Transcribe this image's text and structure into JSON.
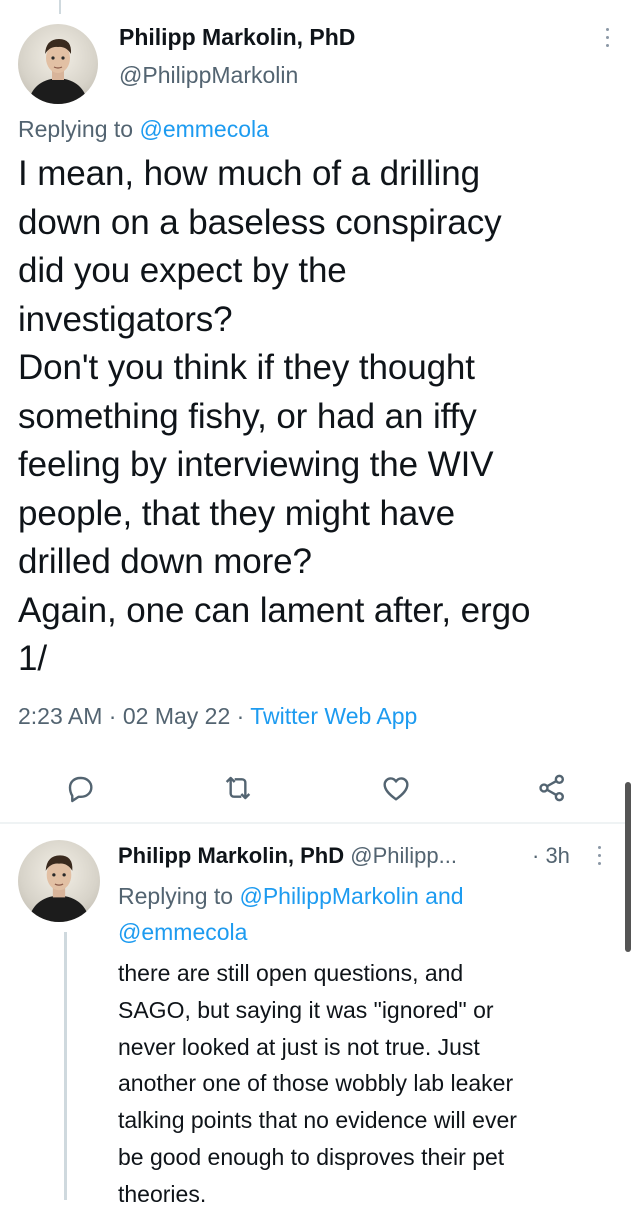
{
  "main_tweet": {
    "author_name": "Philipp Markolin, PhD",
    "author_handle": "@PhilippMarkolin",
    "replying_prefix": "Replying to ",
    "replying_to": "@emmecola",
    "text_lines": [
      "I mean, how much of a drilling",
      "down on a baseless conspiracy",
      "did you expect by the",
      "investigators?",
      "Don't you think if they thought",
      "something fishy, or had an iffy",
      "feeling by interviewing the WIV",
      "people, that they might have",
      "drilled down more?",
      "Again, one can lament after, ergo",
      "1/"
    ],
    "time": "2:23 AM",
    "separator": " · ",
    "date": "02 May 22",
    "source": "Twitter Web App"
  },
  "actions": {
    "icons": [
      "reply-icon",
      "retweet-icon",
      "like-icon",
      "share-icon"
    ]
  },
  "reply_tweet": {
    "author_name": "Philipp Markolin, PhD",
    "author_handle": "@Philipp...",
    "time": "· 3h",
    "replying_prefix": "Replying to ",
    "replying_to_1": "@PhilippMarkolin",
    "replying_and": " and",
    "replying_to_2": "@emmecola",
    "text_lines": [
      "there are still open questions, and",
      "SAGO, but saying it was \"ignored\" or",
      "never looked at just is not true. Just",
      "another one of those wobbly lab leaker",
      "talking points that no evidence will ever",
      "be good enough to disproves their pet",
      "theories."
    ]
  },
  "colors": {
    "text": "#0f1419",
    "secondary": "#536471",
    "link": "#1d9bf0",
    "divider": "#eff3f4"
  }
}
